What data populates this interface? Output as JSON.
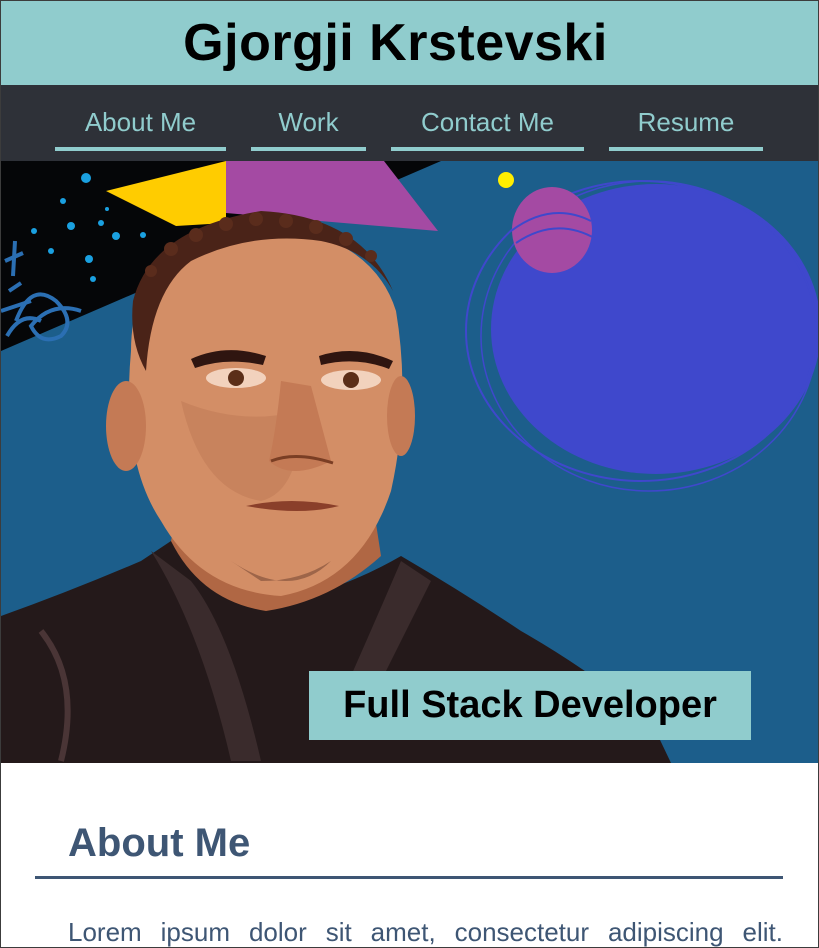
{
  "header": {
    "title": "Gjorgji Krstevski"
  },
  "nav": {
    "items": [
      {
        "label": "About Me"
      },
      {
        "label": "Work"
      },
      {
        "label": "Contact Me"
      },
      {
        "label": "Resume"
      }
    ]
  },
  "hero": {
    "image": "portrait-illustration",
    "caption": "Full Stack Developer"
  },
  "about": {
    "heading": "About Me",
    "text": "Lorem ipsum dolor sit amet, consectetur adipiscing elit."
  },
  "colors": {
    "accent": "#90cccd",
    "nav_background": "#2e3138",
    "hero_background": "#1c5e8b",
    "heading": "#3e5674"
  }
}
